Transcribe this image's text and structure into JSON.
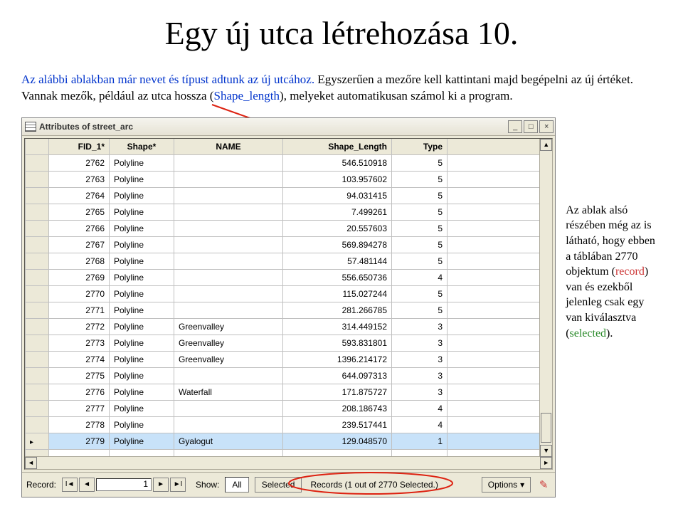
{
  "title": "Egy új utca létrehozása 10.",
  "intro": {
    "p1a": "Az alábbi ablakban már nevet és típust adtunk az új utcához.",
    "p1b_pre": " Egyszerűen a mezőre kell kattintani majd begépelni az új értéket. Vannak mezők, például az utca hossza (",
    "shape_len": "Shape_length",
    "p1b_post": "), melyeket automatikusan számol ki a program."
  },
  "window": {
    "title": "Attributes of street_arc",
    "columns": [
      "FID_1*",
      "Shape*",
      "NAME",
      "Shape_Length",
      "Type"
    ],
    "rows": [
      {
        "fid": "2762",
        "shape": "Polyline",
        "name": "",
        "len": "546.510918",
        "type": "5"
      },
      {
        "fid": "2763",
        "shape": "Polyline",
        "name": "",
        "len": "103.957602",
        "type": "5"
      },
      {
        "fid": "2764",
        "shape": "Polyline",
        "name": "",
        "len": "94.031415",
        "type": "5"
      },
      {
        "fid": "2765",
        "shape": "Polyline",
        "name": "",
        "len": "7.499261",
        "type": "5"
      },
      {
        "fid": "2766",
        "shape": "Polyline",
        "name": "",
        "len": "20.557603",
        "type": "5"
      },
      {
        "fid": "2767",
        "shape": "Polyline",
        "name": "",
        "len": "569.894278",
        "type": "5"
      },
      {
        "fid": "2768",
        "shape": "Polyline",
        "name": "",
        "len": "57.481144",
        "type": "5"
      },
      {
        "fid": "2769",
        "shape": "Polyline",
        "name": "",
        "len": "556.650736",
        "type": "4"
      },
      {
        "fid": "2770",
        "shape": "Polyline",
        "name": "",
        "len": "115.027244",
        "type": "5"
      },
      {
        "fid": "2771",
        "shape": "Polyline",
        "name": "",
        "len": "281.266785",
        "type": "5"
      },
      {
        "fid": "2772",
        "shape": "Polyline",
        "name": "Greenvalley",
        "len": "314.449152",
        "type": "3"
      },
      {
        "fid": "2773",
        "shape": "Polyline",
        "name": "Greenvalley",
        "len": "593.831801",
        "type": "3"
      },
      {
        "fid": "2774",
        "shape": "Polyline",
        "name": "Greenvalley",
        "len": "1396.214172",
        "type": "3"
      },
      {
        "fid": "2775",
        "shape": "Polyline",
        "name": "",
        "len": "644.097313",
        "type": "3"
      },
      {
        "fid": "2776",
        "shape": "Polyline",
        "name": "Waterfall",
        "len": "171.875727",
        "type": "3"
      },
      {
        "fid": "2777",
        "shape": "Polyline",
        "name": "",
        "len": "208.186743",
        "type": "4"
      },
      {
        "fid": "2778",
        "shape": "Polyline",
        "name": "",
        "len": "239.517441",
        "type": "4"
      },
      {
        "fid": "2779",
        "shape": "Polyline",
        "name": "Gyalogut",
        "len": "129.048570",
        "type": "1",
        "selected": true
      }
    ]
  },
  "status": {
    "record_label": "Record:",
    "current": "1",
    "show_label": "Show:",
    "all": "All",
    "selected": "Selected",
    "summary": "Records (1 out of 2770 Selected.)",
    "options": "Options"
  },
  "sidenote": {
    "a": "Az ablak alsó részében még az is látható, hogy ebben a táblában 2770 objektum (",
    "rec": "record",
    "b": ") van és ezekből jelenleg csak egy van kiválasztva (",
    "sel": "selected",
    "c": ")."
  }
}
